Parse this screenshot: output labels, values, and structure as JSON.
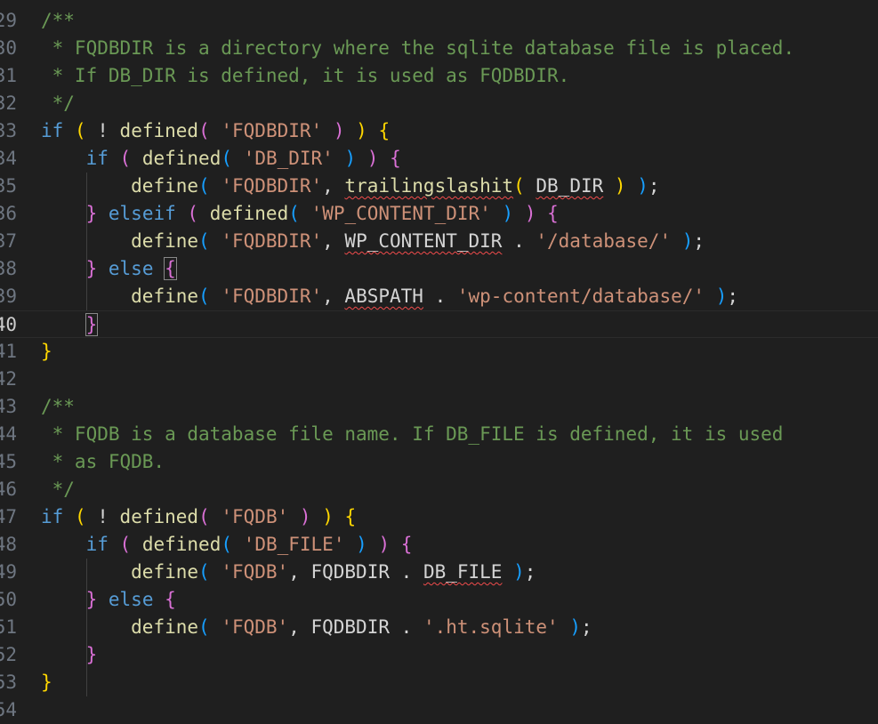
{
  "editor": {
    "active_line": "40",
    "lines": [
      {
        "n": "29",
        "t": [
          [
            "/**",
            "c"
          ]
        ]
      },
      {
        "n": "30",
        "t": [
          [
            " * FQDBDIR is a directory where the sqlite database file is placed.",
            "c"
          ]
        ]
      },
      {
        "n": "31",
        "t": [
          [
            " * If DB_DIR is defined, it is used as FQDBDIR.",
            "c"
          ]
        ]
      },
      {
        "n": "32",
        "t": [
          [
            " */",
            "c"
          ]
        ]
      },
      {
        "n": "33",
        "t": [
          [
            "if",
            "k"
          ],
          [
            " ",
            "o"
          ],
          [
            "(",
            "p1"
          ],
          [
            " ! ",
            "o"
          ],
          [
            "defined",
            "f"
          ],
          [
            "(",
            "p2"
          ],
          [
            " ",
            "o"
          ],
          [
            "'FQDBDIR'",
            "s"
          ],
          [
            " ",
            "o"
          ],
          [
            ")",
            "p2"
          ],
          [
            " ",
            "o"
          ],
          [
            ")",
            "p1"
          ],
          [
            " ",
            "o"
          ],
          [
            "{",
            "p1"
          ]
        ]
      },
      {
        "n": "34",
        "t": [
          [
            "    ",
            "o"
          ],
          [
            "if",
            "k"
          ],
          [
            " ",
            "o"
          ],
          [
            "(",
            "p2"
          ],
          [
            " ",
            "o"
          ],
          [
            "defined",
            "f"
          ],
          [
            "(",
            "p3"
          ],
          [
            " ",
            "o"
          ],
          [
            "'DB_DIR'",
            "s"
          ],
          [
            " ",
            "o"
          ],
          [
            ")",
            "p3"
          ],
          [
            " ",
            "o"
          ],
          [
            ")",
            "p2"
          ],
          [
            " ",
            "o"
          ],
          [
            "{",
            "p2"
          ]
        ]
      },
      {
        "n": "35",
        "t": [
          [
            "        ",
            "o"
          ],
          [
            "define",
            "f"
          ],
          [
            "(",
            "p3"
          ],
          [
            " ",
            "o"
          ],
          [
            "'FQDBDIR'",
            "s"
          ],
          [
            ", ",
            "o"
          ],
          [
            "trailingslashit",
            "fq"
          ],
          [
            "(",
            "p1"
          ],
          [
            " ",
            "o"
          ],
          [
            "DB_DIR",
            "cq"
          ],
          [
            " ",
            "o"
          ],
          [
            ")",
            "p1"
          ],
          [
            " ",
            "o"
          ],
          [
            ")",
            "p3"
          ],
          [
            ";",
            "o"
          ]
        ]
      },
      {
        "n": "36",
        "t": [
          [
            "    ",
            "o"
          ],
          [
            "}",
            "p2"
          ],
          [
            " ",
            "o"
          ],
          [
            "elseif",
            "k"
          ],
          [
            " ",
            "o"
          ],
          [
            "(",
            "p2"
          ],
          [
            " ",
            "o"
          ],
          [
            "defined",
            "f"
          ],
          [
            "(",
            "p3"
          ],
          [
            " ",
            "o"
          ],
          [
            "'WP_CONTENT_DIR'",
            "s"
          ],
          [
            " ",
            "o"
          ],
          [
            ")",
            "p3"
          ],
          [
            " ",
            "o"
          ],
          [
            ")",
            "p2"
          ],
          [
            " ",
            "o"
          ],
          [
            "{",
            "p2"
          ]
        ]
      },
      {
        "n": "37",
        "t": [
          [
            "        ",
            "o"
          ],
          [
            "define",
            "f"
          ],
          [
            "(",
            "p3"
          ],
          [
            " ",
            "o"
          ],
          [
            "'FQDBDIR'",
            "s"
          ],
          [
            ", ",
            "o"
          ],
          [
            "WP_CONTENT_DIR",
            "cq"
          ],
          [
            " . ",
            "o"
          ],
          [
            "'/database/'",
            "s"
          ],
          [
            " ",
            "o"
          ],
          [
            ")",
            "p3"
          ],
          [
            ";",
            "o"
          ]
        ]
      },
      {
        "n": "38",
        "t": [
          [
            "    ",
            "o"
          ],
          [
            "}",
            "p2"
          ],
          [
            " ",
            "o"
          ],
          [
            "else",
            "k"
          ],
          [
            " ",
            "o"
          ],
          [
            "{",
            "p2b"
          ]
        ]
      },
      {
        "n": "39",
        "t": [
          [
            "        ",
            "o"
          ],
          [
            "define",
            "f"
          ],
          [
            "(",
            "p3"
          ],
          [
            " ",
            "o"
          ],
          [
            "'FQDBDIR'",
            "s"
          ],
          [
            ", ",
            "o"
          ],
          [
            "ABSPATH",
            "cq"
          ],
          [
            " . ",
            "o"
          ],
          [
            "'wp-content/database/'",
            "s"
          ],
          [
            " ",
            "o"
          ],
          [
            ")",
            "p3"
          ],
          [
            ";",
            "o"
          ]
        ]
      },
      {
        "n": "40",
        "t": [
          [
            "    ",
            "o"
          ],
          [
            "}",
            "p2b"
          ]
        ]
      },
      {
        "n": "41",
        "t": [
          [
            "}",
            "p1"
          ]
        ]
      },
      {
        "n": "42",
        "t": []
      },
      {
        "n": "43",
        "t": [
          [
            "/**",
            "c"
          ]
        ]
      },
      {
        "n": "44",
        "t": [
          [
            " * FQDB is a database file name. If DB_FILE is defined, it is used",
            "c"
          ]
        ]
      },
      {
        "n": "45",
        "t": [
          [
            " * as FQDB.",
            "c"
          ]
        ]
      },
      {
        "n": "46",
        "t": [
          [
            " */",
            "c"
          ]
        ]
      },
      {
        "n": "47",
        "t": [
          [
            "if",
            "k"
          ],
          [
            " ",
            "o"
          ],
          [
            "(",
            "p1"
          ],
          [
            " ! ",
            "o"
          ],
          [
            "defined",
            "f"
          ],
          [
            "(",
            "p2"
          ],
          [
            " ",
            "o"
          ],
          [
            "'FQDB'",
            "s"
          ],
          [
            " ",
            "o"
          ],
          [
            ")",
            "p2"
          ],
          [
            " ",
            "o"
          ],
          [
            ")",
            "p1"
          ],
          [
            " ",
            "o"
          ],
          [
            "{",
            "p1"
          ]
        ]
      },
      {
        "n": "48",
        "t": [
          [
            "    ",
            "o"
          ],
          [
            "if",
            "k"
          ],
          [
            " ",
            "o"
          ],
          [
            "(",
            "p2"
          ],
          [
            " ",
            "o"
          ],
          [
            "defined",
            "f"
          ],
          [
            "(",
            "p3"
          ],
          [
            " ",
            "o"
          ],
          [
            "'DB_FILE'",
            "s"
          ],
          [
            " ",
            "o"
          ],
          [
            ")",
            "p3"
          ],
          [
            " ",
            "o"
          ],
          [
            ")",
            "p2"
          ],
          [
            " ",
            "o"
          ],
          [
            "{",
            "p2"
          ]
        ]
      },
      {
        "n": "49",
        "t": [
          [
            "        ",
            "o"
          ],
          [
            "define",
            "f"
          ],
          [
            "(",
            "p3"
          ],
          [
            " ",
            "o"
          ],
          [
            "'FQDB'",
            "s"
          ],
          [
            ", ",
            "o"
          ],
          [
            "FQDBDIR",
            "cn"
          ],
          [
            " . ",
            "o"
          ],
          [
            "DB_FILE",
            "cq"
          ],
          [
            " ",
            "o"
          ],
          [
            ")",
            "p3"
          ],
          [
            ";",
            "o"
          ]
        ]
      },
      {
        "n": "50",
        "t": [
          [
            "    ",
            "o"
          ],
          [
            "}",
            "p2"
          ],
          [
            " ",
            "o"
          ],
          [
            "else",
            "k"
          ],
          [
            " ",
            "o"
          ],
          [
            "{",
            "p2"
          ]
        ]
      },
      {
        "n": "51",
        "t": [
          [
            "        ",
            "o"
          ],
          [
            "define",
            "f"
          ],
          [
            "(",
            "p3"
          ],
          [
            " ",
            "o"
          ],
          [
            "'FQDB'",
            "s"
          ],
          [
            ", ",
            "o"
          ],
          [
            "FQDBDIR",
            "cn"
          ],
          [
            " . ",
            "o"
          ],
          [
            "'.ht.sqlite'",
            "s"
          ],
          [
            " ",
            "o"
          ],
          [
            ")",
            "p3"
          ],
          [
            ";",
            "o"
          ]
        ]
      },
      {
        "n": "52",
        "t": [
          [
            "    ",
            "o"
          ],
          [
            "}",
            "p2"
          ]
        ]
      },
      {
        "n": "53",
        "t": [
          [
            "}",
            "p1"
          ]
        ]
      },
      {
        "n": "54",
        "t": []
      }
    ]
  },
  "colors": {
    "background": "#1f1f1f",
    "comment": "#6a9955",
    "keyword": "#569cd6",
    "function": "#dcdcaa",
    "string": "#ce9178",
    "bracket_1": "#ffd700",
    "bracket_2": "#da70d6",
    "bracket_3": "#179fff",
    "error_squiggle": "#f14c4c"
  }
}
